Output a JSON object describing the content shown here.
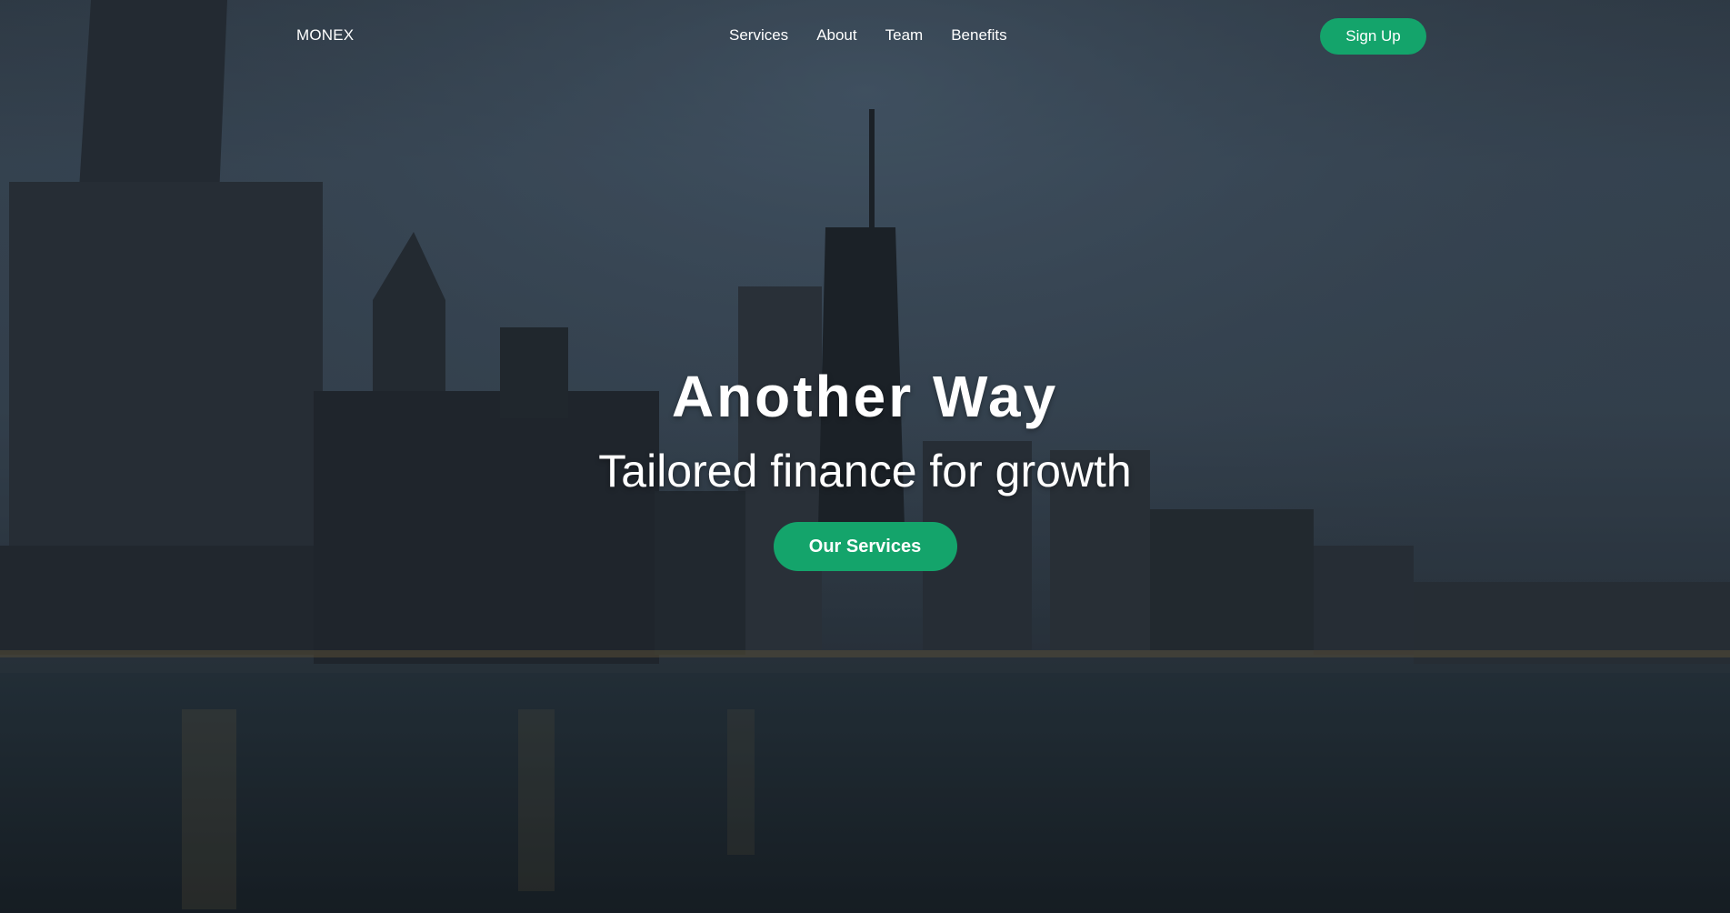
{
  "nav": {
    "brand": "MONEX",
    "links": [
      "Services",
      "About",
      "Team",
      "Benefits"
    ],
    "signup_label": "Sign Up"
  },
  "hero": {
    "title": "Another Way",
    "subtitle": "Tailored finance for growth",
    "cta_label": "Our Services"
  },
  "colors": {
    "accent": "#14a46b",
    "overlay_sky": "#3a4856"
  }
}
